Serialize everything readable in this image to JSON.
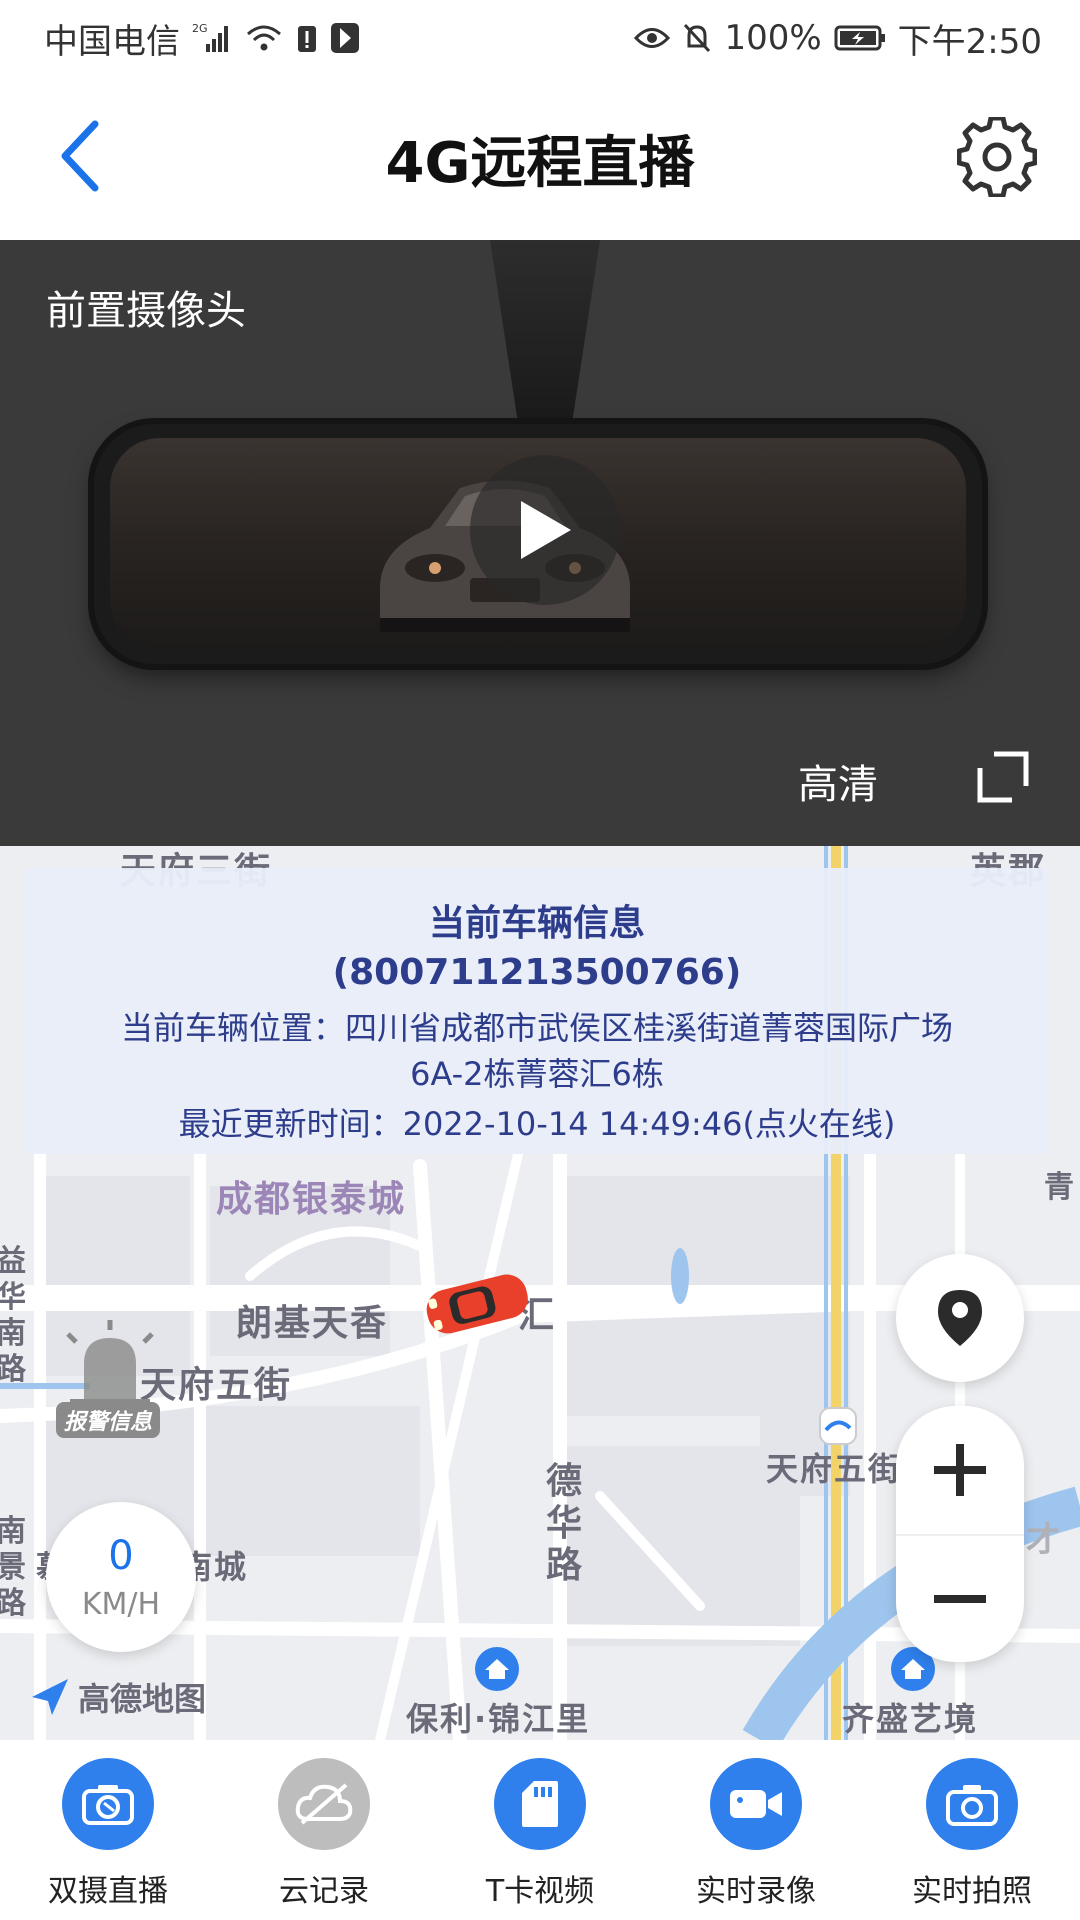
{
  "status_bar": {
    "carrier": "中国电信",
    "network": "2G",
    "battery": "100%",
    "time": "下午2:50"
  },
  "header": {
    "title": "4G远程直播"
  },
  "video": {
    "camera_label": "前置摄像头",
    "quality_label": "高清"
  },
  "vehicle_info": {
    "title": "当前车辆信息",
    "vehicle_id": "(800711213500766)",
    "location_label": "当前车辆位置：",
    "location_line1": "四川省成都市武侯区桂溪街道菁蓉国际广场",
    "location_line2": "6A-2栋菁蓉汇6栋",
    "time_label": "最近更新时间：",
    "time_value": "2022-10-14 14:49:46(点火在线)"
  },
  "map": {
    "labels": {
      "top_left": "天府三街",
      "top_right": "英郡",
      "yintai": "成都银泰城",
      "langji": "朗基天香",
      "hui": "汇",
      "tianfu5_left": "天府五街",
      "tianfu5_right": "天府五街",
      "dehua_1": "德",
      "dehua_2": "华",
      "dehua_3": "路",
      "nancheng": "南城",
      "poly": "保利·锦江里",
      "qisheng": "齐盛艺境",
      "yucai": "育才",
      "qing": "青",
      "left_road_1": "益",
      "left_road_2": "华",
      "left_road_3": "南",
      "left_road_4": "路",
      "left_road_5": "南",
      "left_road_6": "景",
      "left_road_7": "路",
      "left_road_8": "慕"
    },
    "alarm_label": "报警信息",
    "speed_value": "0",
    "speed_unit": "KM/H",
    "provider": "高德地图"
  },
  "bottom_nav": [
    {
      "label": "双摄直播",
      "icon": "dual-camera-icon",
      "color": "#2f80ed"
    },
    {
      "label": "云记录",
      "icon": "cloud-off-icon",
      "color": "#bdbdbd"
    },
    {
      "label": "T卡视频",
      "icon": "sd-card-icon",
      "color": "#2f80ed"
    },
    {
      "label": "实时录像",
      "icon": "video-camera-icon",
      "color": "#2f80ed"
    },
    {
      "label": "实时拍照",
      "icon": "camera-icon",
      "color": "#2f80ed"
    }
  ]
}
